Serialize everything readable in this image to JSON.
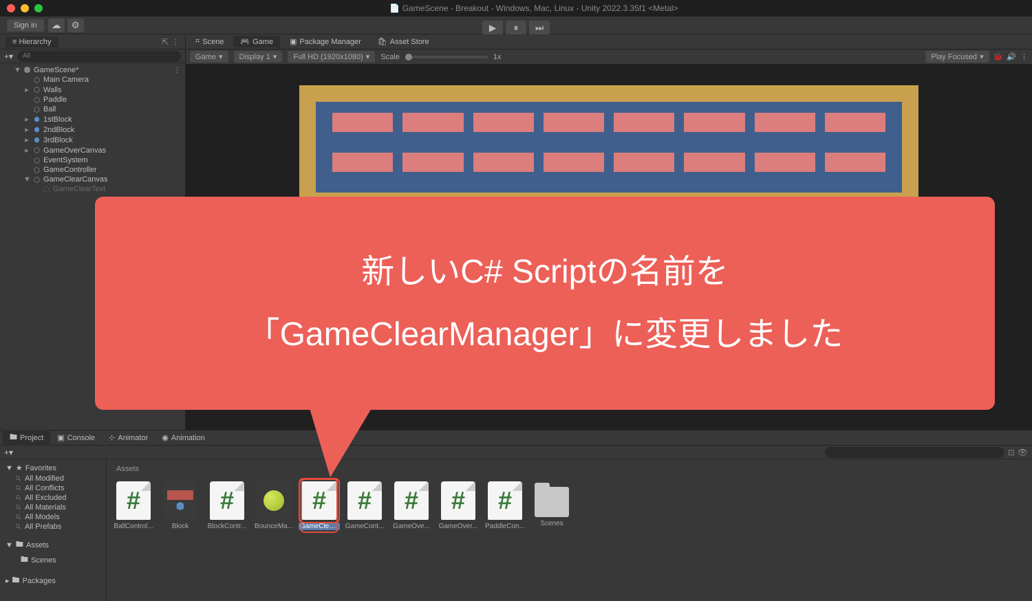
{
  "title": "GameScene - Breakout - Windows, Mac, Linux - Unity 2022.3.35f1 <Metal>",
  "signin": "Sign in",
  "hierarchy": {
    "title": "Hierarchy",
    "search_placeholder": "All",
    "scene": "GameScene*",
    "items": [
      "Main Camera",
      "Walls",
      "Paddle",
      "Ball",
      "1stBlock",
      "2ndBlock",
      "3rdBlock",
      "GameOverCanvas",
      "EventSystem",
      "GameController",
      "GameClearCanvas"
    ],
    "child_item": "GameClearText"
  },
  "scene_tabs": {
    "scene": "Scene",
    "game": "Game",
    "package": "Package Manager",
    "asset_store": "Asset Store"
  },
  "scene_toolbar": {
    "game": "Game",
    "display": "Display 1",
    "resolution": "Full HD (1920x1080)",
    "scale": "Scale",
    "scale_val": "1x",
    "play_focused": "Play Focused"
  },
  "callout": {
    "line1": "新しいC# Scriptの名前を",
    "line2": "「GameClearManager」に変更しました"
  },
  "bottom": {
    "project": "Project",
    "console": "Console",
    "animator": "Animator",
    "animation": "Animation",
    "favorites": "Favorites",
    "fav_items": [
      "All Modified",
      "All Conflicts",
      "All Excluded",
      "All Materials",
      "All Models",
      "All Prefabs"
    ],
    "assets": "Assets",
    "scenes": "Scenes",
    "packages": "Packages",
    "breadcrumb": "Assets",
    "grid": [
      {
        "label": "BallControl...",
        "type": "script"
      },
      {
        "label": "Block",
        "type": "prefab"
      },
      {
        "label": "BlockContr...",
        "type": "script"
      },
      {
        "label": "BounceMa...",
        "type": "bounce"
      },
      {
        "label": "GameClea...",
        "type": "script",
        "selected": true
      },
      {
        "label": "GameCont...",
        "type": "script"
      },
      {
        "label": "GameOve...",
        "type": "script"
      },
      {
        "label": "GameOver...",
        "type": "script"
      },
      {
        "label": "PaddleCon...",
        "type": "script"
      },
      {
        "label": "Scenes",
        "type": "folder"
      }
    ]
  }
}
